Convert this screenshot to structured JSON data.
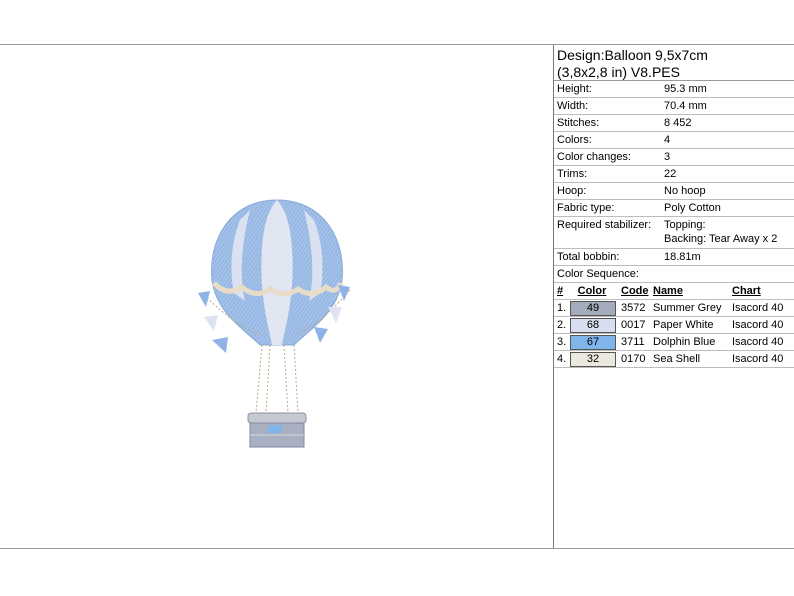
{
  "design": {
    "title_line1": "Design:Balloon 9,5x7cm",
    "title_line2": "(3,8x2,8 in) V8.PES"
  },
  "specs": [
    {
      "label": "Height:",
      "value": "95.3 mm"
    },
    {
      "label": "Width:",
      "value": "70.4 mm"
    },
    {
      "label": "Stitches:",
      "value": "8 452"
    },
    {
      "label": "Colors:",
      "value": "4"
    },
    {
      "label": "Color changes:",
      "value": "3"
    },
    {
      "label": "Trims:",
      "value": "22"
    },
    {
      "label": "Hoop:",
      "value": "No hoop"
    },
    {
      "label": "Fabric type:",
      "value": "Poly Cotton"
    }
  ],
  "stabilizer": {
    "label": "Required stabilizer:",
    "line1": "Topping:",
    "line2": "Backing: Tear Away x 2"
  },
  "bobbin": {
    "label": "Total bobbin:",
    "value": "18.81m"
  },
  "color_sequence": {
    "heading": "Color Sequence:",
    "columns": {
      "num": "#",
      "color": "Color",
      "code": "Code",
      "name": "Name",
      "chart": "Chart"
    },
    "rows": [
      {
        "num": "1.",
        "swatch": "49",
        "code": "3572",
        "name": "Summer Grey",
        "chart": "Isacord 40",
        "hex": "#a3acbd"
      },
      {
        "num": "2.",
        "swatch": "68",
        "code": "0017",
        "name": "Paper White",
        "chart": "Isacord 40",
        "hex": "#d6def0"
      },
      {
        "num": "3.",
        "swatch": "67",
        "code": "3711",
        "name": "Dolphin Blue",
        "chart": "Isacord 40",
        "hex": "#7fb5ea"
      },
      {
        "num": "4.",
        "swatch": "32",
        "code": "0170",
        "name": "Sea Shell",
        "chart": "Isacord 40",
        "hex": "#ebe8e0"
      }
    ]
  }
}
